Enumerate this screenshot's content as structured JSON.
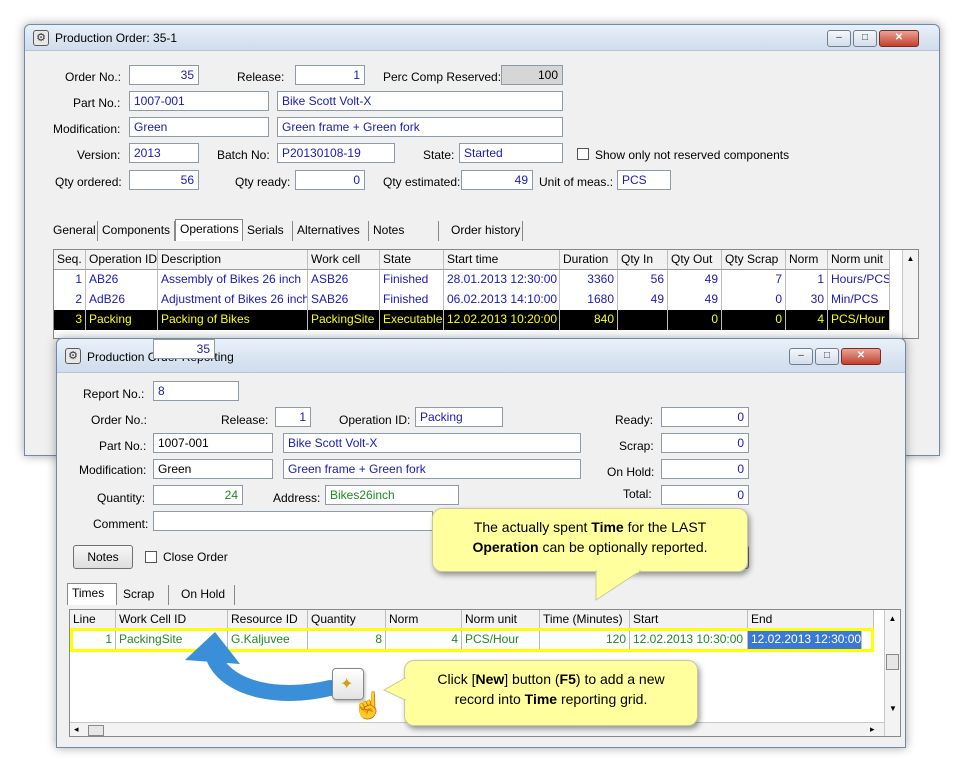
{
  "main_window": {
    "title": "Production Order: 35-1",
    "labels": {
      "order_no": "Order No.:",
      "release": "Release:",
      "perc_comp_reserved": "Perc Comp Reserved:",
      "part_no": "Part No.:",
      "modification": "Modification:",
      "version": "Version:",
      "batch_no": "Batch No:",
      "state": "State:",
      "show_only": "Show only not reserved components",
      "qty_ordered": "Qty ordered:",
      "qty_ready": "Qty ready:",
      "qty_estimated": "Qty estimated:",
      "unit_of_meas": "Unit of meas.:"
    },
    "values": {
      "order_no": "35",
      "release": "1",
      "perc_comp_reserved": "100",
      "part_no": "1007-001",
      "part_desc": "Bike Scott Volt-X",
      "modification": "Green",
      "modification_desc": "Green frame + Green fork",
      "version": "2013",
      "batch_no": "P20130108-19",
      "state": "Started",
      "qty_ordered": "56",
      "qty_ready": "0",
      "qty_estimated": "49",
      "unit_of_meas": "PCS"
    },
    "tabs": [
      "General",
      "Components",
      "Operations",
      "Serials",
      "Alternatives",
      "Notes",
      "Order history"
    ],
    "grid": {
      "headers": [
        "Seq.",
        "Operation ID",
        "Description",
        "Work cell",
        "State",
        "Start time",
        "Duration",
        "Qty In",
        "Qty Out",
        "Qty Scrap",
        "Norm",
        "Norm unit"
      ],
      "rows": [
        [
          "1",
          "AB26",
          "Assembly of Bikes 26 inch",
          "ASB26",
          "Finished",
          "28.01.2013 12:30:00",
          "3360",
          "56",
          "49",
          "7",
          "1",
          "Hours/PCS"
        ],
        [
          "2",
          "AdB26",
          "Adjustment of Bikes 26 inch",
          "SAB26",
          "Finished",
          "06.02.2013 14:10:00",
          "1680",
          "49",
          "49",
          "0",
          "30",
          "Min/PCS"
        ],
        [
          "3",
          "Packing",
          "Packing of Bikes",
          "PackingSite",
          "Executable",
          "12.02.2013 10:20:00",
          "840",
          "",
          "0",
          "0",
          "4",
          "PCS/Hour"
        ]
      ]
    }
  },
  "report_window": {
    "title": "Production Order Reporting",
    "labels": {
      "report_no": "Report No.:",
      "order_no": "Order No.:",
      "release": "Release:",
      "operation_id": "Operation ID:",
      "part_no": "Part No.:",
      "modification": "Modification:",
      "quantity": "Quantity:",
      "address": "Address:",
      "comment": "Comment:",
      "ready": "Ready:",
      "scrap": "Scrap:",
      "on_hold": "On Hold:",
      "total": "Total:",
      "close_order": "Close Order"
    },
    "values": {
      "report_no": "8",
      "order_no": "35",
      "release": "1",
      "operation_id": "Packing",
      "part_no": "1007-001",
      "part_desc": "Bike Scott Volt-X",
      "modification": "Green",
      "modification_desc": "Green frame + Green fork",
      "quantity": "24",
      "address": "Bikes26inch",
      "ready": "0",
      "scrap": "0",
      "on_hold": "0",
      "total": "0"
    },
    "notes_button": "Notes",
    "tabs": [
      "Times",
      "Scrap",
      "On Hold"
    ],
    "grid": {
      "headers": [
        "Line",
        "Work Cell ID",
        "Resource ID",
        "Quantity",
        "Norm",
        "Norm unit",
        "Time (Minutes)",
        "Start",
        "End"
      ],
      "rows": [
        [
          "1",
          "PackingSite",
          "G.Kaljuvee",
          "8",
          "4",
          "PCS/Hour",
          "120",
          "12.02.2013 10:30:00",
          "12.02.2013 12:30:00"
        ]
      ]
    }
  },
  "callouts": {
    "time_pre": "The actually spent ",
    "time_b1": "Time",
    "time_mid": " for the LAST",
    "time_b2": "Operation",
    "time_post": " can be optionally reported.",
    "new_pre": "Click [",
    "new_b1": "New",
    "new_mid": "] button (",
    "new_b2": "F5",
    "new_mid2": ") to add a new",
    "new_line2_pre": "record into ",
    "new_b3": "Time",
    "new_line2_post": " reporting grid."
  },
  "colors": {
    "highlight": "#ffff00",
    "callout_bg": "#ffff9e",
    "arrow": "#3b8fd9"
  }
}
